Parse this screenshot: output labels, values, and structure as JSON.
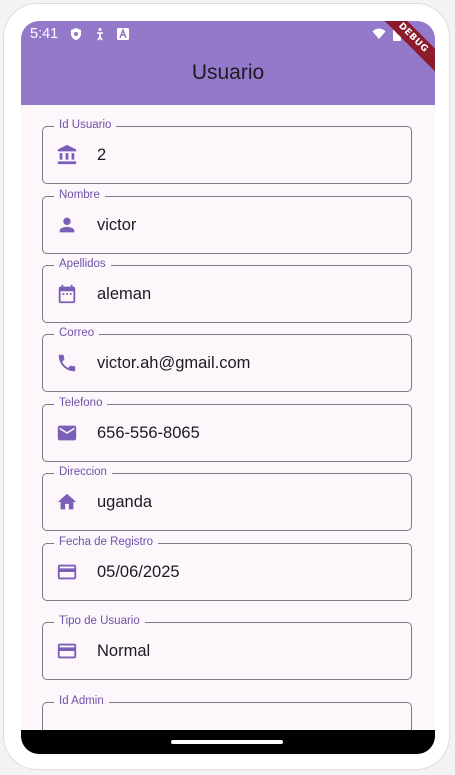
{
  "status_bar": {
    "time": "5:41"
  },
  "app_bar": {
    "title": "Usuario",
    "debug_banner": "DEBUG"
  },
  "form": {
    "fields": [
      {
        "label": "Id Usuario",
        "value": "2",
        "icon": "bank-icon"
      },
      {
        "label": "Nombre",
        "value": "victor",
        "icon": "person-icon"
      },
      {
        "label": "Apellidos",
        "value": "aleman",
        "icon": "calendar-icon"
      },
      {
        "label": "Correo",
        "value": "victor.ah@gmail.com",
        "icon": "phone-icon"
      },
      {
        "label": "Telefono",
        "value": "656-556-8065",
        "icon": "mail-icon"
      },
      {
        "label": "Direccion",
        "value": "uganda",
        "icon": "home-icon"
      },
      {
        "label": "Fecha de Registro",
        "value": "05/06/2025",
        "icon": "credit-card-icon"
      },
      {
        "label": "Tipo de Usuario",
        "value": "Normal",
        "icon": "credit-card-icon"
      },
      {
        "label": "Id Admin",
        "value": "",
        "icon": ""
      }
    ]
  },
  "colors": {
    "app_bar": "#9479cb",
    "accent": "#6d53a6",
    "background": "#fdf7fc",
    "icon": "#7b5fb6"
  }
}
